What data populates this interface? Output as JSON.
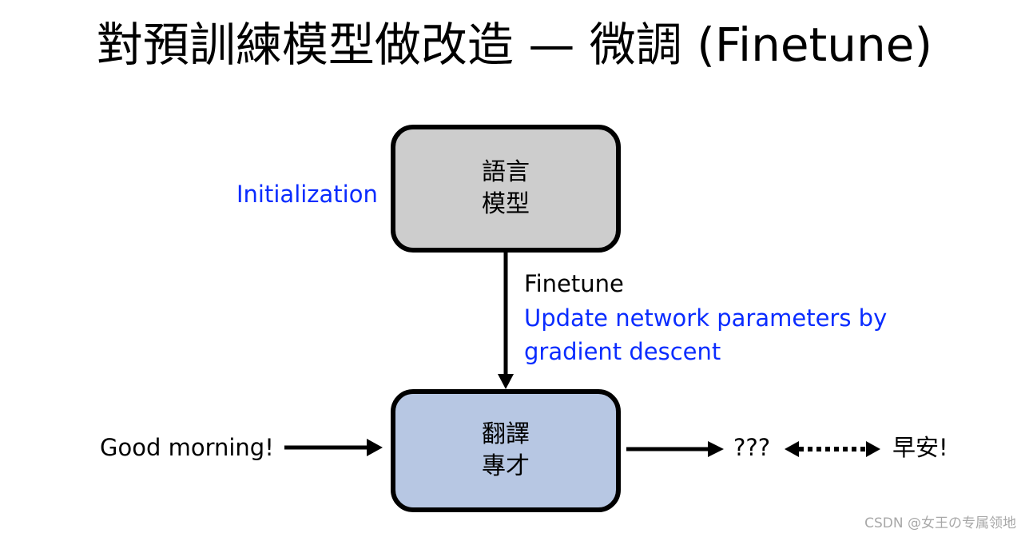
{
  "title": "對預訓練模型做改造 — 微調 (Finetune)",
  "diagram": {
    "nodes": [
      {
        "id": "language-model",
        "line1": "語言",
        "line2": "模型",
        "fill": "#cdcdcd"
      },
      {
        "id": "translation-expert",
        "line1": "翻譯",
        "line2": "專才",
        "fill": "#b7c7e3"
      }
    ],
    "labels": {
      "initialization": "Initialization",
      "finetune": "Finetune",
      "finetune_desc_1": "Update network parameters by",
      "finetune_desc_2": "gradient descent",
      "input": "Good morning!",
      "output": "???",
      "target": "早安!"
    },
    "edges": [
      {
        "from": "language-model",
        "to": "translation-expert",
        "style": "solid",
        "label": "Finetune"
      },
      {
        "from": "input",
        "to": "translation-expert",
        "style": "solid"
      },
      {
        "from": "translation-expert",
        "to": "output",
        "style": "solid"
      },
      {
        "from": "output",
        "to": "target",
        "style": "dotted-bidirectional"
      }
    ],
    "accent_color": "#0a2cff"
  },
  "watermark": "CSDN @女王の专属领地"
}
